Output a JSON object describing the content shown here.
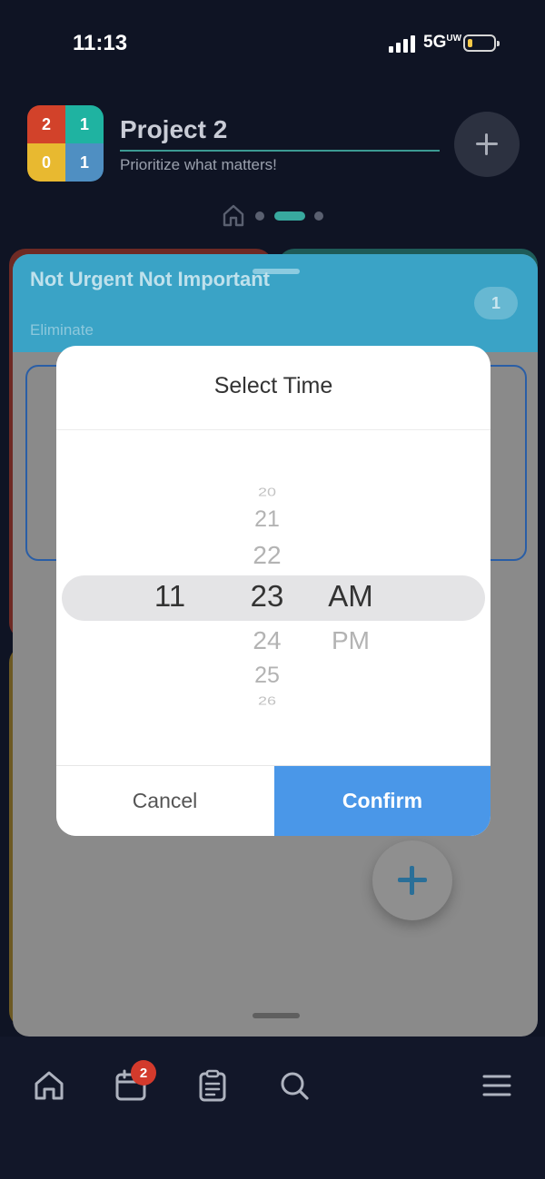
{
  "status_bar": {
    "time": "11:13",
    "network": "5G",
    "network_suffix": "UW"
  },
  "header": {
    "logo_cells": [
      "2",
      "1",
      "0",
      "1"
    ],
    "project_title": "Project 2",
    "project_subtitle": "Prioritize what matters!"
  },
  "card": {
    "title": "Not Urgent Not Important",
    "subtitle": "Eliminate",
    "count": "1"
  },
  "modal": {
    "title": "Select Time",
    "picker": {
      "hour": "11",
      "minutes_above": [
        "20",
        "21",
        "22"
      ],
      "minute": "23",
      "minutes_below": [
        "24",
        "25",
        "26"
      ],
      "period": "AM",
      "period_other": "PM"
    },
    "cancel_label": "Cancel",
    "confirm_label": "Confirm"
  },
  "nav": {
    "calendar_badge": "2",
    "items": [
      "home-icon",
      "calendar-icon",
      "clipboard-icon",
      "search-icon",
      "menu-icon"
    ]
  },
  "colors": {
    "background": "#0f1424",
    "logo_red": "#d2422a",
    "logo_teal": "#1fb3a1",
    "logo_yellow": "#e8b930",
    "logo_blue": "#4f8fc2",
    "card_header": "#3aa3c6",
    "confirm": "#4a97e8",
    "badge": "#d33a2c"
  }
}
